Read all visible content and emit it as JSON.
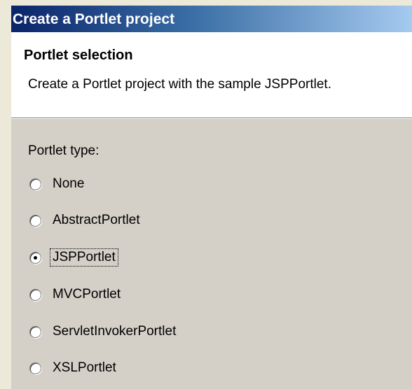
{
  "window": {
    "title": "Create a Portlet project"
  },
  "header": {
    "title": "Portlet selection",
    "description": "Create a Portlet project with the sample JSPPortlet."
  },
  "portlet_type": {
    "label": "Portlet type:",
    "selected": "JSPPortlet",
    "options": [
      {
        "label": "None",
        "checked": false
      },
      {
        "label": "AbstractPortlet",
        "checked": false
      },
      {
        "label": "JSPPortlet",
        "checked": true
      },
      {
        "label": "MVCPortlet",
        "checked": false
      },
      {
        "label": "ServletInvokerPortlet",
        "checked": false
      },
      {
        "label": "XSLPortlet",
        "checked": false
      }
    ]
  },
  "colors": {
    "titlebar_start": "#0a246a",
    "titlebar_end": "#a6caf0",
    "dialog_background": "#d4d0c8",
    "header_background": "#ffffff"
  }
}
